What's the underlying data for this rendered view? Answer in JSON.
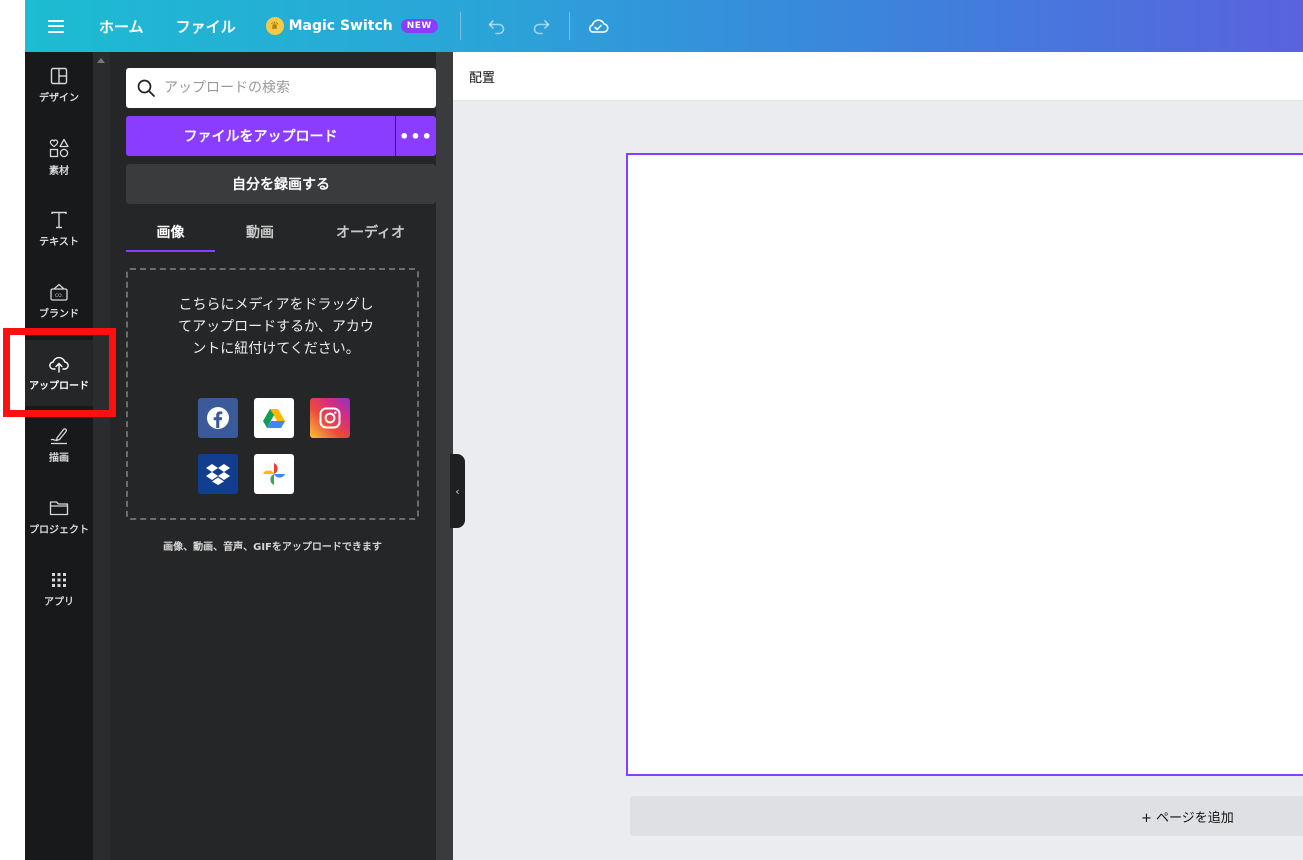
{
  "topbar": {
    "home_label": "ホーム",
    "file_label": "ファイル",
    "magic_switch_label": "Magic Switch",
    "new_badge": "NEW"
  },
  "rail": {
    "items": [
      {
        "label": "デザイン",
        "icon": "layout-icon"
      },
      {
        "label": "素材",
        "icon": "elements-icon"
      },
      {
        "label": "テキスト",
        "icon": "text-icon"
      },
      {
        "label": "ブランド",
        "icon": "brand-icon"
      },
      {
        "label": "アップロード",
        "icon": "upload-cloud-icon"
      },
      {
        "label": "描画",
        "icon": "draw-icon"
      },
      {
        "label": "プロジェクト",
        "icon": "folder-icon"
      },
      {
        "label": "アプリ",
        "icon": "apps-grid-icon"
      }
    ],
    "active_index": 4
  },
  "panel": {
    "search_placeholder": "アップロードの検索",
    "upload_button": "ファイルをアップロード",
    "more_button": "•••",
    "record_button": "自分を録画する",
    "tabs": [
      {
        "label": "画像",
        "active": true
      },
      {
        "label": "動画",
        "active": false
      },
      {
        "label": "オーディオ",
        "active": false
      }
    ],
    "dropzone_text": "こちらにメディアをドラッグしてアップロードするか、アカウントに紐付けてください。",
    "services": [
      "facebook",
      "google-drive",
      "instagram",
      "dropbox",
      "google-photos"
    ],
    "hint": "画像、動画、音声、GIFをアップロードできます"
  },
  "canvas": {
    "toolbar_label": "配置",
    "add_page_label": "+ ページを追加"
  },
  "colors": {
    "accent": "#8b3dff",
    "rail_bg": "#18191b",
    "panel_bg": "#252627",
    "highlight": "#ff1010"
  }
}
